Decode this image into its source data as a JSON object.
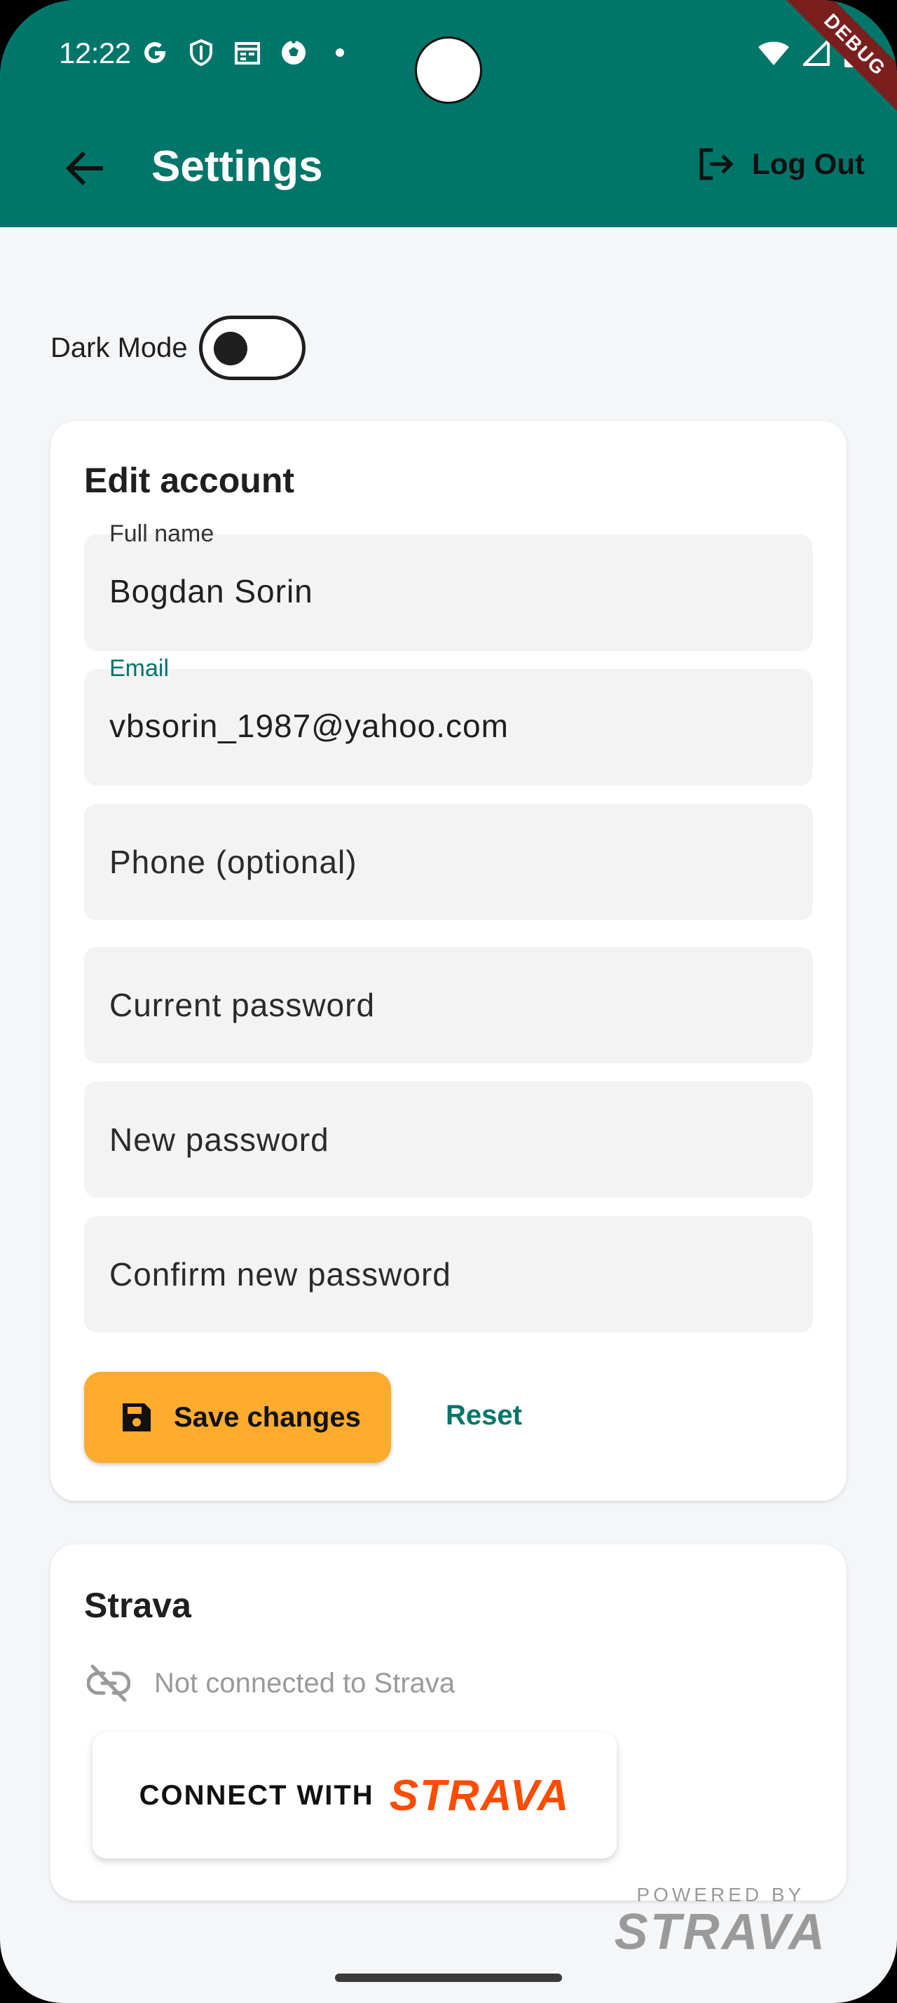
{
  "status_bar": {
    "time": "12:22",
    "icons": [
      "google-icon",
      "shield-icon",
      "calendar-icon",
      "soccer-ball-icon",
      "dot-icon"
    ],
    "right_icons": [
      "wifi-icon",
      "signal-icon",
      "battery-icon"
    ]
  },
  "debug_banner": "DEBUG",
  "appbar": {
    "title": "Settings",
    "logout_label": "Log Out",
    "color": "#00756a"
  },
  "dark_mode": {
    "label": "Dark Mode",
    "enabled": false
  },
  "account": {
    "title": "Edit account",
    "full_name_label": "Full name",
    "full_name_value": "Bogdan Sorin",
    "email_label": "Email",
    "email_value": "vbsorin_1987@yahoo.com",
    "phone_placeholder": "Phone (optional)",
    "current_password_placeholder": "Current password",
    "new_password_placeholder": "New password",
    "confirm_password_placeholder": "Confirm new password",
    "save_label": "Save changes",
    "reset_label": "Reset",
    "accent": "#ffab2e"
  },
  "strava": {
    "title": "Strava",
    "status": "Not connected to Strava",
    "connect_prefix": "CONNECT WITH",
    "connect_brand": "STRAVA",
    "brand_color": "#fc4c02",
    "powered_by": "POWERED BY",
    "powered_brand": "STRAVA"
  }
}
